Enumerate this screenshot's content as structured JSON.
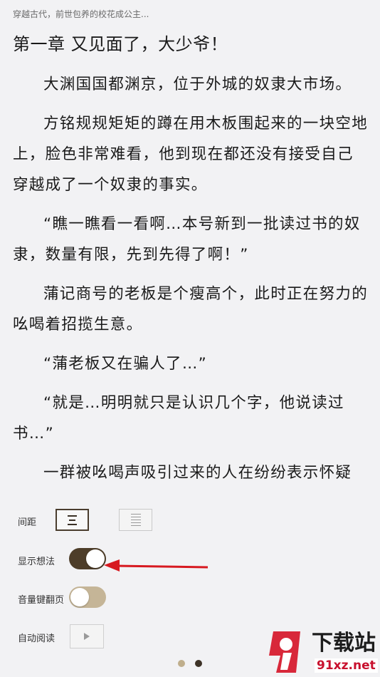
{
  "book_title": "穿越古代，前世包养的校花成公主...",
  "chapter_title": "第一章 又见面了，大少爷！",
  "paragraphs": [
    "大渊国国都渊京，位于外城的奴隶大市场。",
    "方铭规规矩矩的蹲在用木板围起来的一块空地上，脸色非常难看，他到现在都还没有接受自己穿越成了一个奴隶的事实。",
    "“瞧一瞧看一看啊…本号新到一批读过书的奴隶，数量有限，先到先得了啊！”",
    "蒲记商号的老板是个瘦高个，此时正在努力的吆喝着招揽生意。",
    "“蒲老板又在骗人了…”",
    "“就是…明明就只是认识几个字，他说读过书…”",
    "一群被吆喝声吸引过来的人在纷纷表示怀疑"
  ],
  "settings": {
    "spacing_label": "间距",
    "show_thoughts_label": "显示想法",
    "show_thoughts_on": true,
    "volume_key_label": "音量键翻页",
    "volume_key_on": false,
    "auto_read_label": "自动阅读"
  },
  "pager": {
    "count": 2,
    "active_index": 1
  },
  "watermark": {
    "name": "下载站",
    "site": "91xz.net",
    "logo_text": "9"
  },
  "colors": {
    "accent_dark": "#4d3d29",
    "accent_light": "#c5b597",
    "dot_inactive": "#bfae8c",
    "dot_active": "#3d3226",
    "arrow": "#d71920",
    "watermark_red": "#d8283a"
  },
  "icons": {
    "spacing_compact": "lines-compact-icon",
    "spacing_loose": "lines-loose-icon",
    "auto_read": "play-icon",
    "annotation": "red-arrow-icon"
  }
}
